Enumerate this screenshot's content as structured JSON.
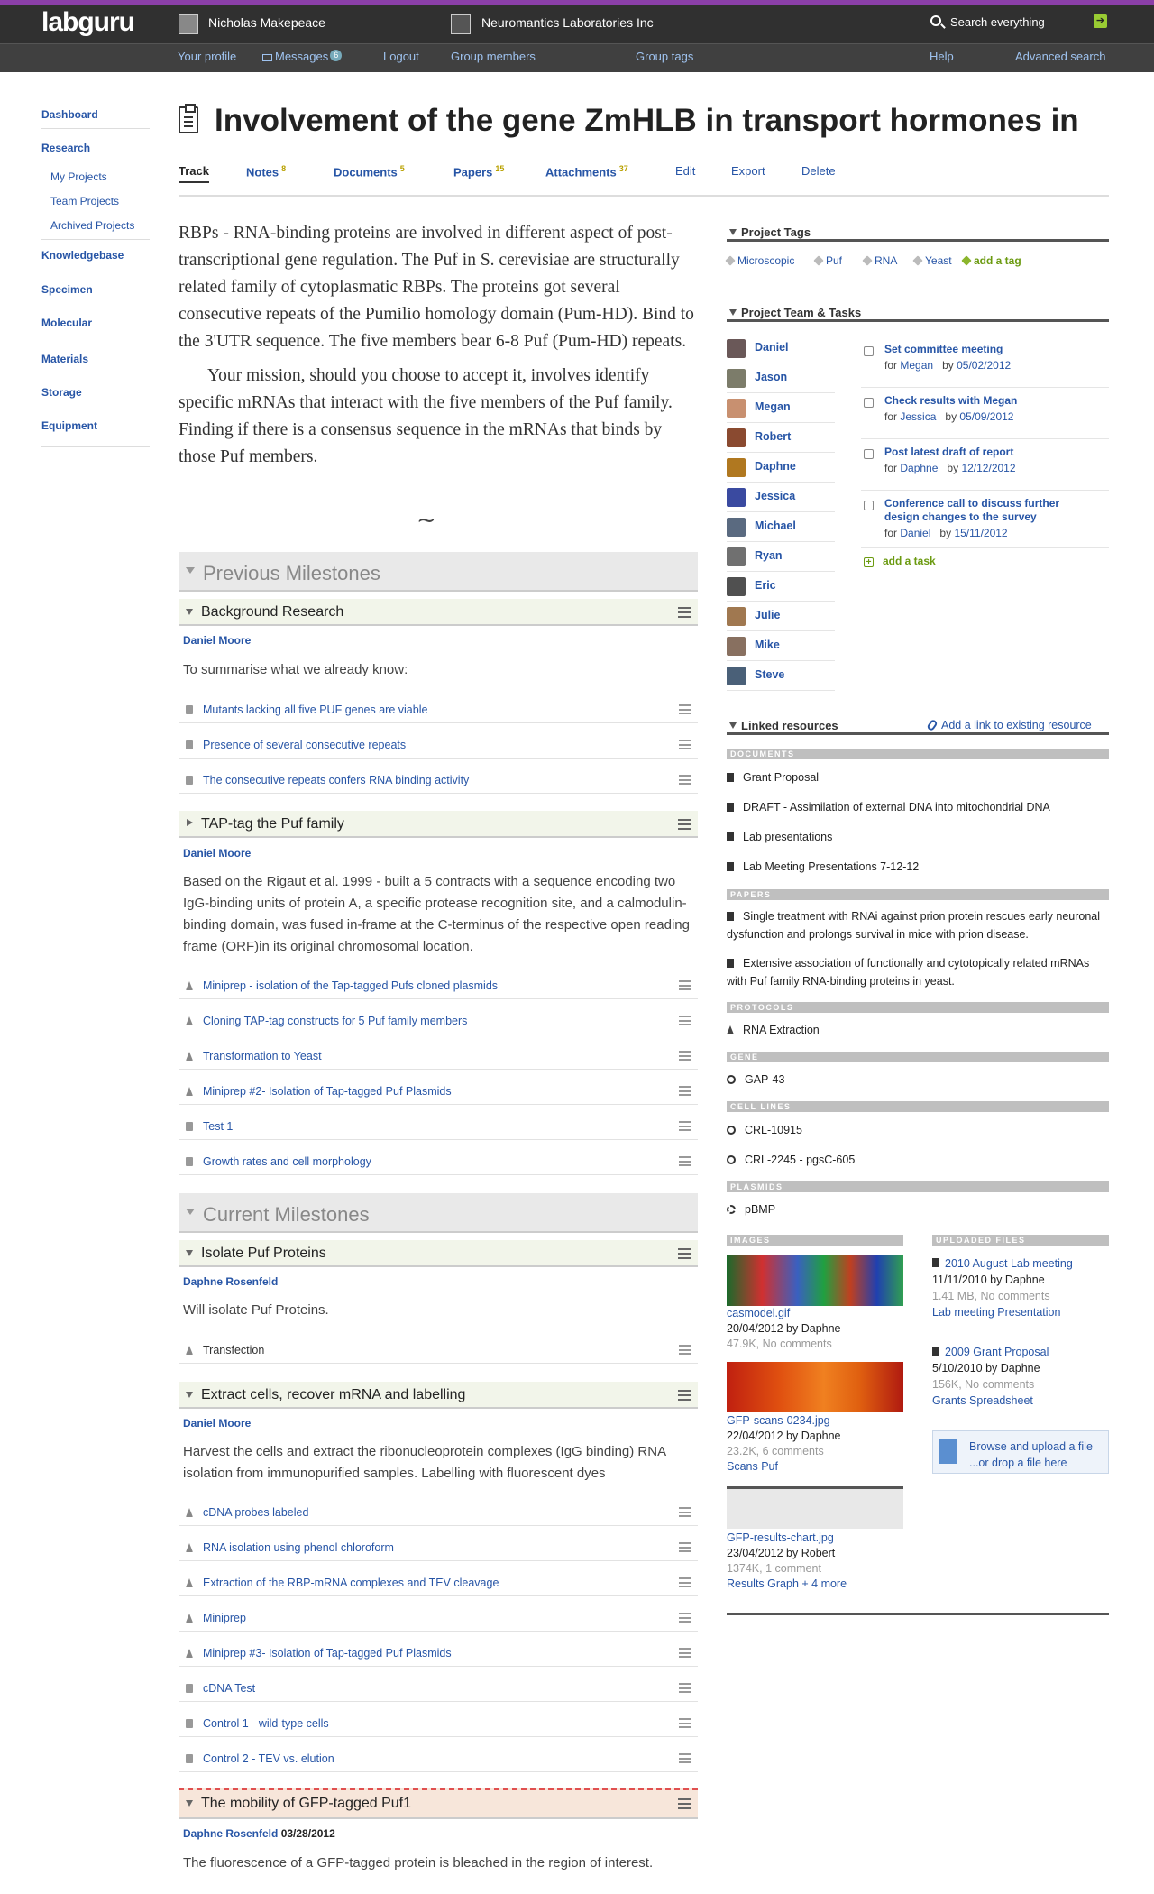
{
  "topbar": {
    "logo": "labguru",
    "user_name": "Nicholas Makepeace",
    "org_name": "Neuromantics Laboratories Inc",
    "search_label": "Search everything",
    "nav": {
      "profile": "Your profile",
      "messages": "Messages",
      "messages_count": "6",
      "logout": "Logout",
      "group_members": "Group members",
      "group_tags": "Group tags",
      "help": "Help",
      "advanced_search": "Advanced search"
    }
  },
  "sidebar": {
    "dashboard": "Dashboard",
    "research": "Research",
    "my_projects": "My Projects",
    "team_projects": "Team Projects",
    "archived_projects": "Archived Projects",
    "knowledgebase": "Knowledgebase",
    "specimen": "Specimen",
    "molecular": "Molecular",
    "materials": "Materials",
    "storage": "Storage",
    "equipment": "Equipment"
  },
  "page": {
    "title": "Involvement of the gene ZmHLB in transport hormones in",
    "tabs": {
      "track": "Track",
      "notes": "Notes",
      "notes_count": "8",
      "documents": "Documents",
      "documents_count": "5",
      "papers": "Papers",
      "papers_count": "15",
      "attachments": "Attachments",
      "attachments_count": "37",
      "edit": "Edit",
      "export": "Export",
      "delete": "Delete"
    },
    "intro_p1": "RBPs - RNA-binding proteins are involved in different aspect of post-transcriptional gene regulation. The Puf in S. cerevisiae are structurally related family of cytoplasmatic RBPs. The proteins got several consecutive repeats of the Pumilio homology domain (Pum-HD). Bind to the 3'UTR sequence. The five members bear 6-8 Puf (Pum-HD) repeats.",
    "intro_p2": "Your mission, should you choose to accept it, involves identify specific mRNAs that interact with the five members of the Puf family. Finding if there is a consensus sequence in the mRNAs that binds by those Puf members.",
    "divider_glyph": "~"
  },
  "previous": {
    "header": "Previous Milestones",
    "m1": {
      "title": "Background Research",
      "owner": "Daniel Moore",
      "desc": "To summarise what we already know:",
      "items": [
        "Mutants lacking all five PUF genes are viable",
        "Presence of several consecutive repeats",
        "The consecutive repeats confers RNA binding activity"
      ]
    },
    "m2": {
      "title": "TAP-tag the Puf family",
      "owner": "Daniel Moore",
      "desc": "Based on the Rigaut et al. 1999 - built a 5 contracts with a sequence encoding two IgG-binding units of protein A, a specific protease recognition site, and a calmodulin-binding domain, was fused in-frame at the C-terminus of the respective open reading frame (ORF)in its original chromosomal location.",
      "items": [
        "Miniprep - isolation of the Tap-tagged Pufs cloned plasmids",
        "Cloning TAP-tag constructs for 5 Puf family members",
        "Transformation to Yeast",
        "Miniprep #2- Isolation of Tap-tagged Puf Plasmids",
        "Test 1",
        "Growth rates and cell morphology"
      ]
    }
  },
  "current": {
    "header": "Current Milestones",
    "m1": {
      "title": "Isolate Puf Proteins",
      "owner": "Daphne Rosenfeld",
      "desc": "Will isolate Puf Proteins.",
      "items": [
        "Transfection"
      ]
    },
    "m2": {
      "title": "Extract cells, recover mRNA and labelling",
      "owner": "Daniel Moore",
      "desc": "Harvest the cells and extract the ribonucleoprotein complexes (IgG binding) RNA isolation from immunopurified samples. Labelling with fluorescent dyes",
      "items": [
        "cDNA probes labeled",
        "RNA isolation using phenol chloroform",
        "Extraction of the RBP-mRNA complexes and TEV cleavage",
        "Miniprep",
        "Miniprep #3- Isolation of Tap-tagged Puf Plasmids",
        "cDNA Test",
        "Control 1 - wild-type cells",
        "Control 2 - TEV vs. elution"
      ]
    },
    "m3": {
      "title": "The mobility of GFP-tagged Puf1",
      "owner": "Daphne Rosenfeld",
      "date": "03/28/2012",
      "desc": "The fluorescence of a GFP-tagged protein is bleached in the region of interest."
    }
  },
  "right": {
    "tags_header": "Project Tags",
    "tags": [
      "Microscopic",
      "Puf",
      "RNA",
      "Yeast"
    ],
    "add_tag": "add a tag",
    "team_header": "Project Team & Tasks",
    "members": [
      "Daniel",
      "Jason",
      "Megan",
      "Robert",
      "Daphne",
      "Jessica",
      "Michael",
      "Ryan",
      "Eric",
      "Julie",
      "Mike",
      "Steve"
    ],
    "tasks": [
      {
        "title": "Set committee meeting",
        "for": "for",
        "who": "Megan",
        "by": "by",
        "date": "05/02/2012"
      },
      {
        "title": "Check results with Megan",
        "for": "for",
        "who": "Jessica",
        "by": "by",
        "date": "05/09/2012"
      },
      {
        "title": "Post latest draft of report",
        "for": "for",
        "who": "Daphne",
        "by": "by",
        "date": "12/12/2012"
      },
      {
        "title": "Conference call to discuss further design changes to the survey",
        "for": "for",
        "who": "Daniel",
        "by": "by",
        "date": "15/11/2012"
      }
    ],
    "add_task": "add a task",
    "linked_header": "Linked resources",
    "add_link": "Add a link to existing resource",
    "cat_documents": "DOCUMENTS",
    "documents": [
      "Grant Proposal",
      "DRAFT - Assimilation of external DNA into mitochondrial DNA",
      "Lab presentations",
      "Lab Meeting Presentations 7-12-12"
    ],
    "cat_papers": "PAPERS",
    "papers": [
      "Single treatment with RNAi against prion protein rescues early neuronal dysfunction and prolongs survival in mice with prion disease.",
      "Extensive association of functionally and cytotopically related mRNAs with Puf family RNA-binding proteins in yeast."
    ],
    "cat_protocols": "PROTOCOLS",
    "protocols": [
      "RNA Extraction"
    ],
    "cat_gene": "GENE",
    "genes": [
      "GAP-43"
    ],
    "cat_cell_lines": "CELL LINES",
    "cell_lines": [
      "CRL-10915",
      "CRL-2245 - pgsC-605"
    ],
    "cat_plasmids": "PLASMIDS",
    "plasmids": [
      "pBMP"
    ],
    "cat_images": "IMAGES",
    "images": [
      {
        "name": "casmodel.gif",
        "date": "20/04/2012 by Daphne",
        "meta": "47.9K, No comments",
        "tags": ""
      },
      {
        "name": "GFP-scans-0234.jpg",
        "date": "22/04/2012 by Daphne",
        "meta": "23.2K, 6 comments",
        "tags": "Scans   Puf"
      },
      {
        "name": "GFP-results-chart.jpg",
        "date": "23/04/2012 by Robert",
        "meta": "1374K, 1 comment",
        "tags": "Results   Graph   + 4 more"
      }
    ],
    "cat_uploaded": "UPLOADED FILES",
    "files": [
      {
        "name": "2010 August Lab meeting",
        "date": "11/11/2010 by Daphne",
        "meta": "1.41 MB, No comments",
        "tags": "Lab meeting   Presentation"
      },
      {
        "name": "2009 Grant Proposal",
        "date": "5/10/2010 by Daphne",
        "meta": "156K, No comments",
        "tags": "Grants   Spreadsheet"
      }
    ],
    "browse_line1": "Browse and upload a file",
    "browse_line2": "...or drop a file here"
  }
}
